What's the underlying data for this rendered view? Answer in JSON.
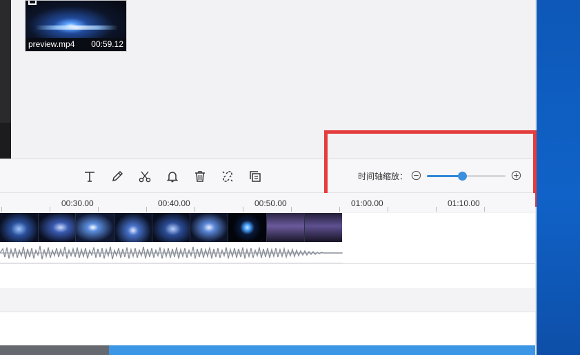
{
  "media": {
    "clip_name": "preview.mp4",
    "clip_duration": "00:59.12"
  },
  "toolbar": {
    "tools": [
      "text-icon",
      "pencil-icon",
      "scissors-icon",
      "bell-icon",
      "trash-icon",
      "unlink-icon",
      "copy-icon"
    ],
    "zoom_label": "时间轴缩放：",
    "zoom_level": 0.45,
    "accent_color": "#2f86d8"
  },
  "ruler": {
    "ticks": [
      "00:30.00",
      "00:40.00",
      "00:50.00",
      "01:00.00",
      "01:10.00"
    ]
  },
  "highlight_color": "#e53d3d"
}
